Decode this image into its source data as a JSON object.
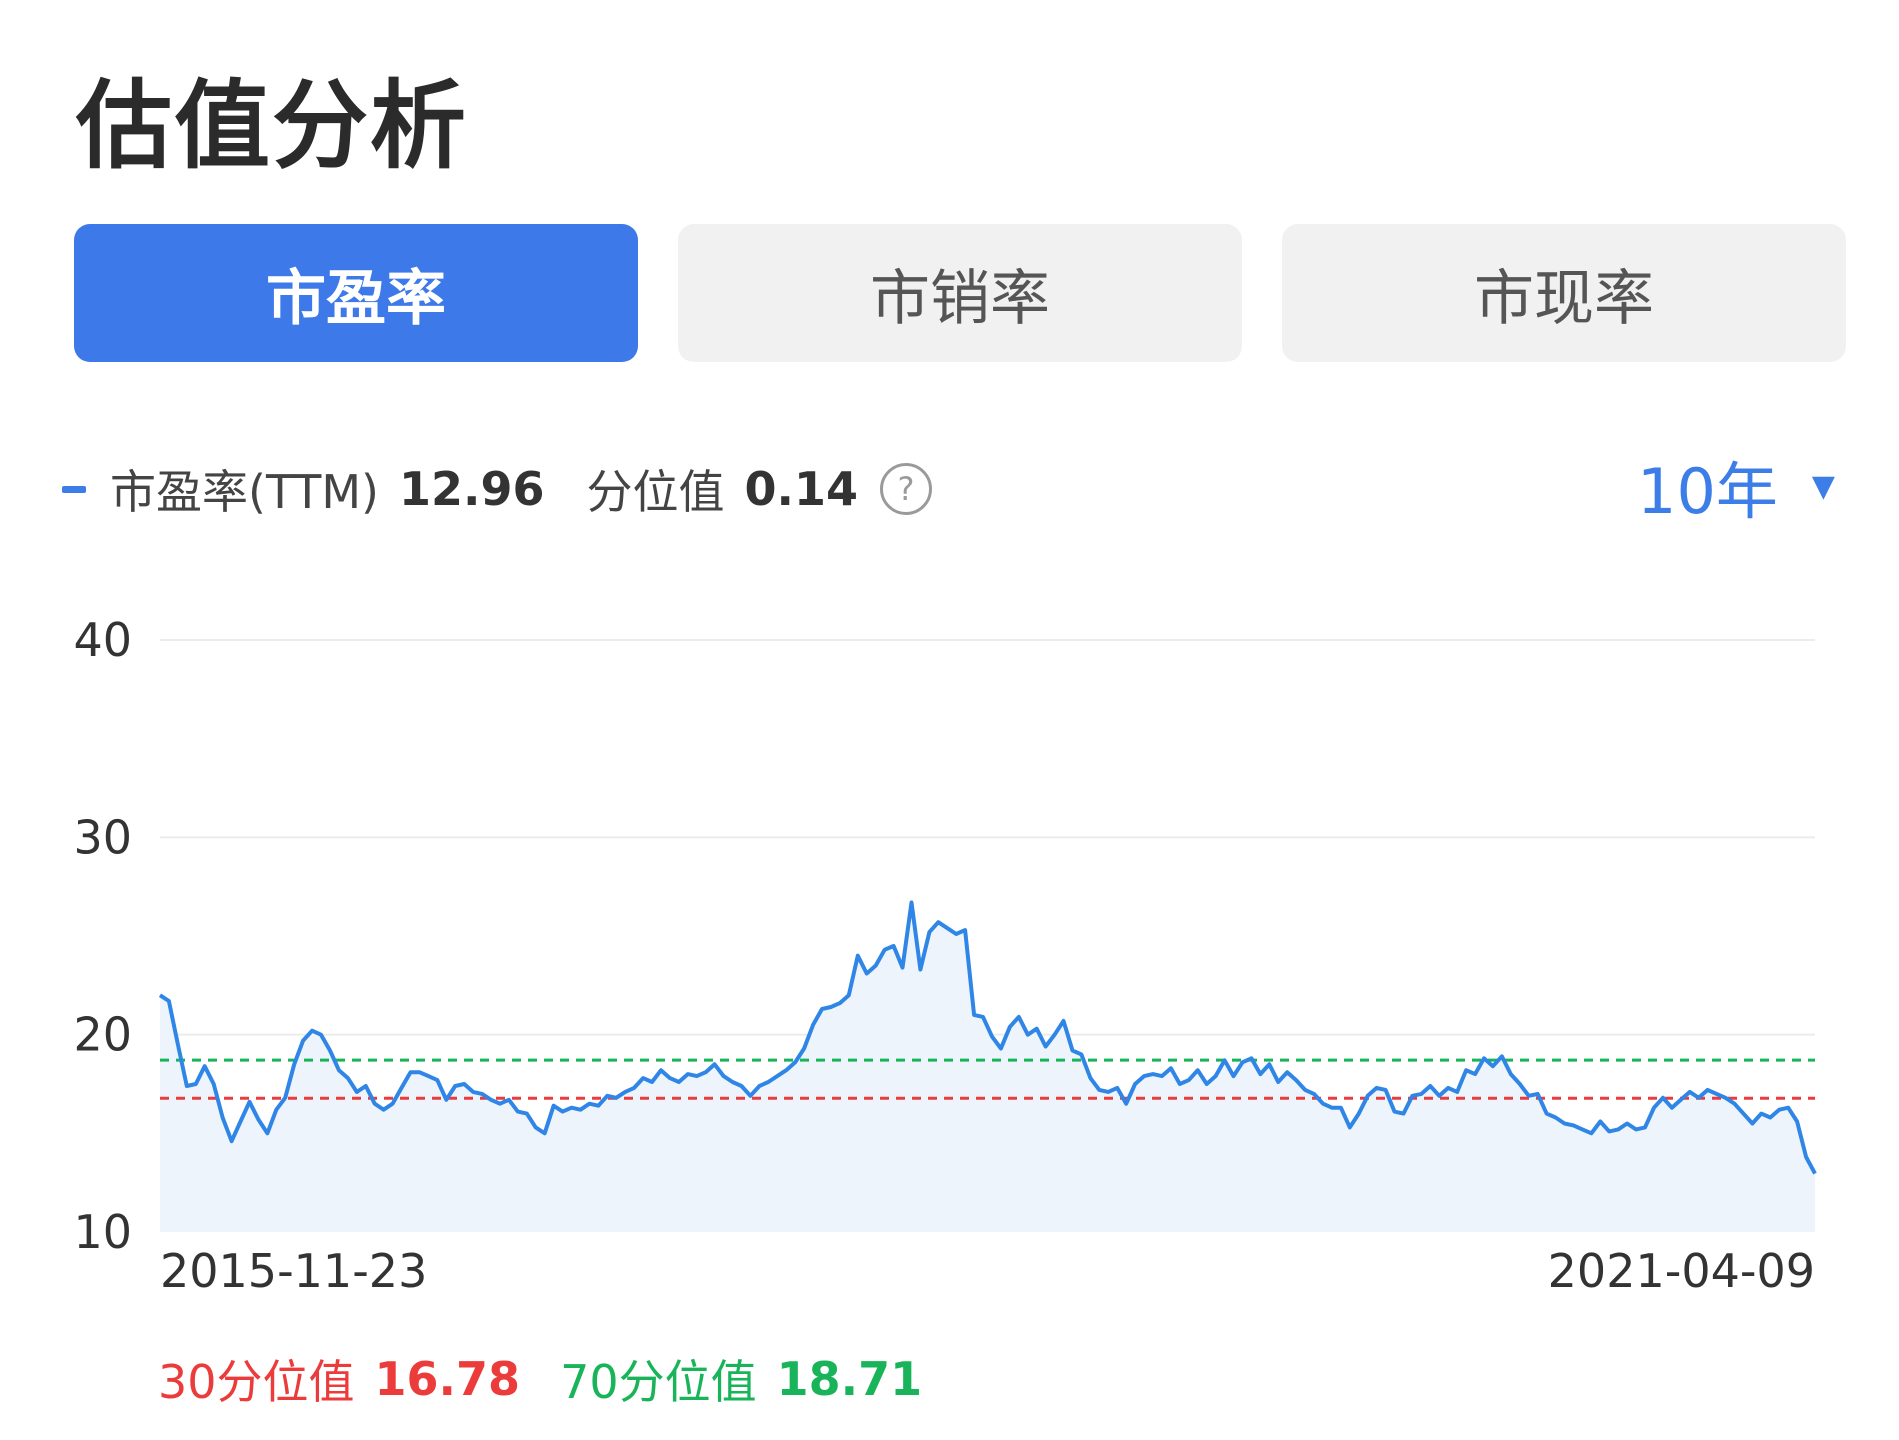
{
  "title": "估值分析",
  "tabs": [
    {
      "label": "市盈率",
      "active": true
    },
    {
      "label": "市销率",
      "active": false
    },
    {
      "label": "市现率",
      "active": false
    }
  ],
  "legend": {
    "series_label": "市盈率(TTM)",
    "current_value": "12.96",
    "percentile_label": "分位值",
    "percentile_value": "0.14",
    "help_icon": "question-circle-icon"
  },
  "period_selector": {
    "label": "10年",
    "icon": "caret-down-icon"
  },
  "percentiles": {
    "p30_label": "30分位值",
    "p30_value": "16.78",
    "p70_label": "70分位值",
    "p70_value": "18.71"
  },
  "colors": {
    "accent": "#3d79e8",
    "line": "#2f86e6",
    "area_fill": "#eef4fc",
    "p30": "#ec3b3b",
    "p70": "#19b45a",
    "grid": "#ececec"
  },
  "chart_data": {
    "type": "area",
    "ylim": [
      10,
      40
    ],
    "yticks": [
      "10",
      "20",
      "30",
      "40"
    ],
    "x_start_label": "2015-11-23",
    "x_end_label": "2021-04-09",
    "grid": true,
    "reference_lines": [
      {
        "name": "30分位值",
        "value": 16.78,
        "style": "dashed",
        "color": "#ec3b3b"
      },
      {
        "name": "70分位值",
        "value": 18.71,
        "style": "dashed",
        "color": "#19b45a"
      }
    ],
    "series": [
      {
        "name": "市盈率(TTM)",
        "values": [
          22.0,
          21.7,
          19.5,
          17.4,
          17.5,
          18.4,
          17.5,
          15.8,
          14.6,
          15.6,
          16.6,
          15.7,
          15.0,
          16.2,
          16.8,
          18.5,
          19.7,
          20.2,
          20.0,
          19.2,
          18.2,
          17.8,
          17.1,
          17.4,
          16.5,
          16.2,
          16.5,
          17.3,
          18.1,
          18.1,
          17.9,
          17.7,
          16.7,
          17.4,
          17.5,
          17.1,
          17.0,
          16.7,
          16.5,
          16.7,
          16.1,
          16.0,
          15.3,
          15.0,
          16.4,
          16.1,
          16.3,
          16.2,
          16.5,
          16.4,
          16.9,
          16.8,
          17.1,
          17.3,
          17.8,
          17.6,
          18.2,
          17.8,
          17.6,
          18.0,
          17.9,
          18.1,
          18.5,
          17.9,
          17.6,
          17.4,
          16.9,
          17.4,
          17.6,
          17.9,
          18.2,
          18.6,
          19.3,
          20.5,
          21.3,
          21.4,
          21.6,
          22.0,
          24.0,
          23.1,
          23.5,
          24.3,
          24.5,
          23.4,
          26.7,
          23.3,
          25.2,
          25.7,
          25.4,
          25.1,
          25.3,
          21.0,
          20.9,
          19.9,
          19.3,
          20.4,
          20.9,
          20.0,
          20.3,
          19.4,
          20.0,
          20.7,
          19.2,
          19.0,
          17.8,
          17.2,
          17.1,
          17.3,
          16.5,
          17.5,
          17.9,
          18.0,
          17.9,
          18.3,
          17.5,
          17.7,
          18.2,
          17.5,
          17.9,
          18.7,
          17.9,
          18.6,
          18.8,
          18.0,
          18.5,
          17.6,
          18.1,
          17.7,
          17.2,
          17.0,
          16.5,
          16.3,
          16.3,
          15.3,
          16.0,
          16.9,
          17.3,
          17.2,
          16.1,
          16.0,
          16.9,
          17.0,
          17.4,
          16.9,
          17.3,
          17.1,
          18.2,
          18.0,
          18.8,
          18.4,
          18.9,
          18.0,
          17.5,
          16.9,
          17.0,
          16.0,
          15.8,
          15.5,
          15.4,
          15.2,
          15.0,
          15.6,
          15.1,
          15.2,
          15.5,
          15.2,
          15.3,
          16.3,
          16.8,
          16.3,
          16.7,
          17.1,
          16.8,
          17.2,
          17.0,
          16.8,
          16.5,
          16.0,
          15.5,
          16.0,
          15.8,
          16.2,
          16.3,
          15.6,
          13.8,
          12.96
        ]
      }
    ]
  }
}
